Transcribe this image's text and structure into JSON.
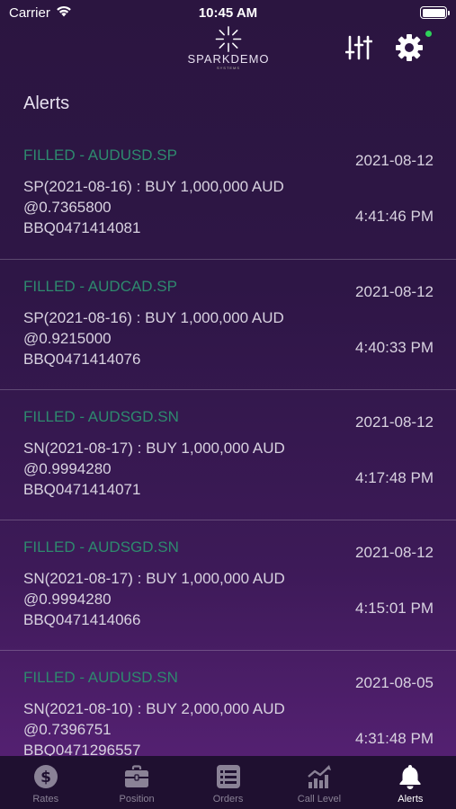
{
  "status_bar": {
    "carrier": "Carrier",
    "time": "10:45 AM"
  },
  "header": {
    "logo_text": "SPARKDEMO",
    "logo_subtext": "SYSTEMS",
    "online_color": "#2ed15a"
  },
  "page": {
    "title": "Alerts"
  },
  "colors": {
    "status_filled": "#2e8a6e",
    "tab_active": "#ffffff",
    "tab_inactive": "#8a8296"
  },
  "alerts": [
    {
      "status": "FILLED - AUDUSD.SP",
      "date": "2021-08-12",
      "line1": "SP(2021-08-16) : BUY 1,000,000 AUD",
      "line2": "@0.7365800",
      "line3": "BBQ0471414081",
      "time": "4:41:46 PM"
    },
    {
      "status": "FILLED - AUDCAD.SP",
      "date": "2021-08-12",
      "line1": "SP(2021-08-16) : BUY 1,000,000 AUD",
      "line2": "@0.9215000",
      "line3": "BBQ0471414076",
      "time": "4:40:33 PM"
    },
    {
      "status": "FILLED - AUDSGD.SN",
      "date": "2021-08-12",
      "line1": "SN(2021-08-17) : BUY 1,000,000 AUD",
      "line2": "@0.9994280",
      "line3": "BBQ0471414071",
      "time": "4:17:48 PM"
    },
    {
      "status": "FILLED - AUDSGD.SN",
      "date": "2021-08-12",
      "line1": "SN(2021-08-17) : BUY 1,000,000 AUD",
      "line2": "@0.9994280",
      "line3": "BBQ0471414066",
      "time": "4:15:01 PM"
    },
    {
      "status": "FILLED - AUDUSD.SN",
      "date": "2021-08-05",
      "line1": "SN(2021-08-10) : BUY 2,000,000 AUD",
      "line2": "@0.7396751",
      "line3": "BBQ0471296557",
      "time": "4:31:48 PM"
    }
  ],
  "tabs": [
    {
      "label": "Rates",
      "icon": "dollar-icon",
      "active": false
    },
    {
      "label": "Position",
      "icon": "briefcase-icon",
      "active": false
    },
    {
      "label": "Orders",
      "icon": "list-icon",
      "active": false
    },
    {
      "label": "Call Level",
      "icon": "chart-trend-icon",
      "active": false
    },
    {
      "label": "Alerts",
      "icon": "bell-icon",
      "active": true
    }
  ]
}
